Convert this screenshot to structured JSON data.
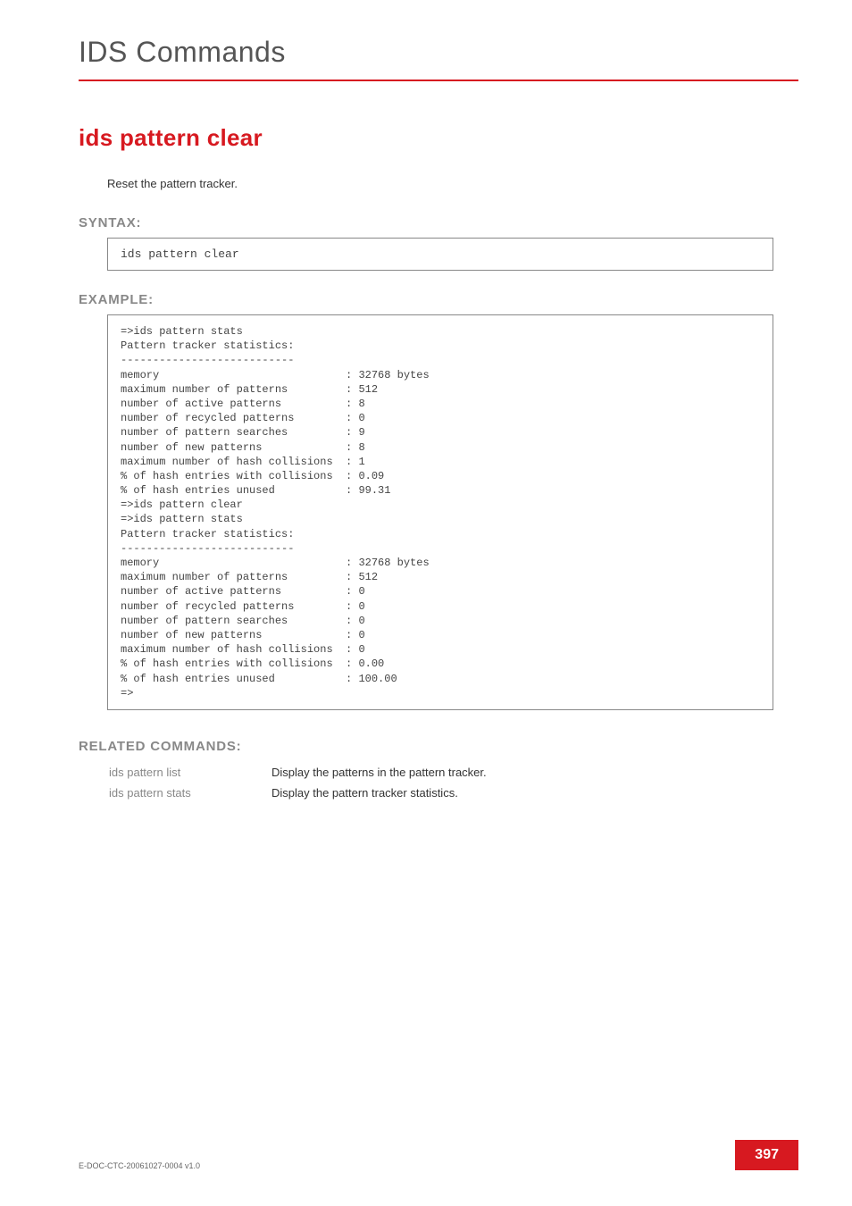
{
  "page": {
    "title": "IDS Commands",
    "command_heading": "ids pattern clear",
    "description": "Reset the pattern tracker."
  },
  "syntax": {
    "label": "SYNTAX:",
    "text": "ids pattern clear"
  },
  "example": {
    "label": "EXAMPLE:",
    "text": "=>ids pattern stats\nPattern tracker statistics:\n---------------------------\nmemory                             : 32768 bytes\nmaximum number of patterns         : 512\nnumber of active patterns          : 8\nnumber of recycled patterns        : 0\nnumber of pattern searches         : 9\nnumber of new patterns             : 8\nmaximum number of hash collisions  : 1\n% of hash entries with collisions  : 0.09\n% of hash entries unused           : 99.31\n=>ids pattern clear\n=>ids pattern stats\nPattern tracker statistics:\n---------------------------\nmemory                             : 32768 bytes\nmaximum number of patterns         : 512\nnumber of active patterns          : 0\nnumber of recycled patterns        : 0\nnumber of pattern searches         : 0\nnumber of new patterns             : 0\nmaximum number of hash collisions  : 0\n% of hash entries with collisions  : 0.00\n% of hash entries unused           : 100.00\n=>"
  },
  "related": {
    "label": "RELATED COMMANDS:",
    "rows": [
      {
        "cmd": "ids pattern list",
        "txt": "Display the patterns in the pattern tracker."
      },
      {
        "cmd": "ids pattern stats",
        "txt": "Display the pattern tracker statistics."
      }
    ]
  },
  "footer": {
    "doc_id": "E-DOC-CTC-20061027-0004 v1.0",
    "page_number": "397"
  }
}
